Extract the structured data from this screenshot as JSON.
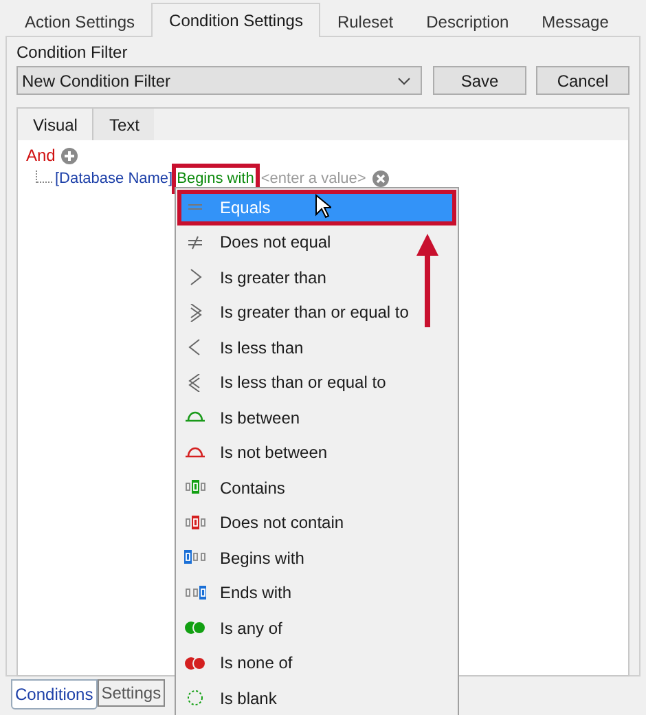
{
  "top_tabs": [
    {
      "label": "Action Settings",
      "selected": false
    },
    {
      "label": "Condition Settings",
      "selected": true
    },
    {
      "label": "Ruleset",
      "selected": false
    },
    {
      "label": "Description",
      "selected": false
    },
    {
      "label": "Message",
      "selected": false
    }
  ],
  "condition_filter": {
    "label": "Condition Filter",
    "value": "New Condition Filter",
    "buttons": [
      "Save",
      "Cancel"
    ]
  },
  "editor_tabs": [
    {
      "label": "Visual",
      "selected": true
    },
    {
      "label": "Text",
      "selected": false
    }
  ],
  "tree": {
    "group": "And",
    "condition": {
      "field": "[Database Name]",
      "operator": "Begins with",
      "operator_highlighted": true,
      "placeholder": "<enter a value>"
    }
  },
  "operator_menu": [
    {
      "kind": "equals",
      "label": "Equals",
      "selected": true,
      "highlighted": true
    },
    {
      "kind": "not-equal",
      "label": "Does not equal",
      "selected": false,
      "highlighted": false
    },
    {
      "kind": "greater",
      "label": "Is greater than",
      "selected": false,
      "highlighted": false
    },
    {
      "kind": "greater-equal",
      "label": "Is greater than or equal to",
      "selected": false,
      "highlighted": false
    },
    {
      "kind": "less",
      "label": "Is less than",
      "selected": false,
      "highlighted": false
    },
    {
      "kind": "less-equal",
      "label": "Is less than or equal to",
      "selected": false,
      "highlighted": false
    },
    {
      "kind": "between",
      "label": "Is between",
      "selected": false,
      "highlighted": false
    },
    {
      "kind": "not-between",
      "label": "Is not between",
      "selected": false,
      "highlighted": false
    },
    {
      "kind": "contains",
      "label": "Contains",
      "selected": false,
      "highlighted": false
    },
    {
      "kind": "not-contains",
      "label": "Does not contain",
      "selected": false,
      "highlighted": false
    },
    {
      "kind": "begins",
      "label": "Begins with",
      "selected": false,
      "highlighted": false
    },
    {
      "kind": "ends",
      "label": "Ends with",
      "selected": false,
      "highlighted": false
    },
    {
      "kind": "any-of",
      "label": "Is any of",
      "selected": false,
      "highlighted": false
    },
    {
      "kind": "none-of",
      "label": "Is none of",
      "selected": false,
      "highlighted": false
    },
    {
      "kind": "blank",
      "label": "Is blank",
      "selected": false,
      "highlighted": false
    }
  ],
  "bottom_tabs": [
    {
      "label": "Conditions",
      "selected": true
    },
    {
      "label": "Settings",
      "selected": false
    }
  ]
}
